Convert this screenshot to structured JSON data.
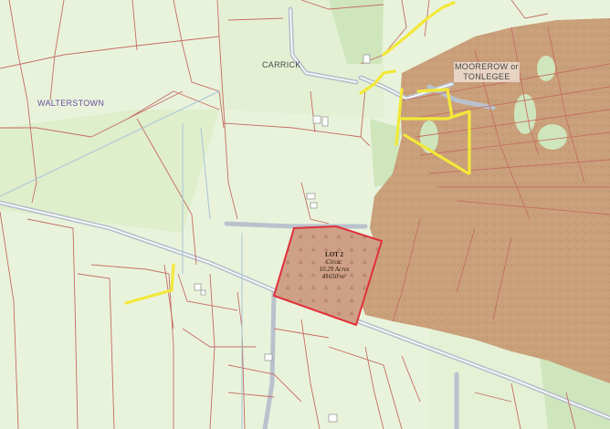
{
  "map": {
    "place_names": {
      "walterstown": "WALTERSTOWN",
      "carrick": "CARRICK",
      "moorerow_line1": "MOOREROW or",
      "moorerow_line2": "TONLEGEE"
    },
    "lot": {
      "title": "LOT 2",
      "circa": "Circa:",
      "acres": "10.29 Acres",
      "area_m2": "41650 m²"
    },
    "colors": {
      "land": "#e9f3dc",
      "woodland": "#c9a07a",
      "lot_fill": "#cfa088",
      "lot_border": "#e0303a",
      "field_boundary": "#c46e64",
      "road": "#b9c2cc",
      "track": "#f2e83a",
      "farmland_green": "#d8ecc2"
    }
  }
}
